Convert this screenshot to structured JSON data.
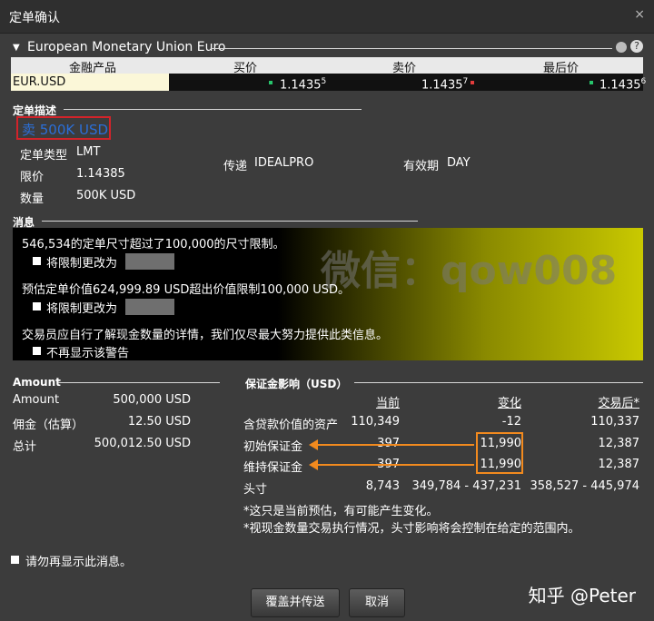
{
  "window": {
    "title": "定单确认",
    "close_icon": "×"
  },
  "instrument": {
    "name": "European Monetary Union Euro"
  },
  "quote_table": {
    "headers": [
      "金融产品",
      "买价",
      "卖价",
      "最后价"
    ],
    "row": {
      "symbol": "EUR.USD",
      "bid": "1.1435",
      "bid_sup": "5",
      "ask": "1.1435",
      "ask_sup": "7",
      "last": "1.1435",
      "last_sup": "6"
    }
  },
  "order": {
    "section": "定单描述",
    "side_text": "卖 500K USD",
    "type_label": "定单类型",
    "type_value": "LMT",
    "limit_label": "限价",
    "limit_value": "1.14385",
    "qty_label": "数量",
    "qty_value": "500K USD",
    "route_label": "传递",
    "route_value": "IDEALPRO",
    "tif_label": "有效期",
    "tif_value": "DAY"
  },
  "messages": {
    "section": "消息",
    "m1": "546,534的定单尺寸超过了100,000的尺寸限制。",
    "m1_opt": "将限制更改为",
    "m2": "预估定单价值624,999.89 USD超出价值限制100,000 USD。",
    "m2_opt": "将限制更改为",
    "m3": "交易员应自行了解现金数量的详情，我们仅尽最大努力提供此类信息。",
    "m3_opt": "不再显示该警告",
    "watermark": "微信：qow008"
  },
  "amount": {
    "section": "Amount",
    "rows": [
      {
        "label": "Amount",
        "value": "500,000 USD"
      },
      {
        "label": "佣金（估算）",
        "value": "12.50 USD"
      },
      {
        "label": "总计",
        "value": "500,012.50 USD"
      }
    ]
  },
  "margin": {
    "section": "保证金影响（USD）",
    "headers": [
      "当前",
      "变化",
      "交易后*"
    ],
    "rows": [
      {
        "label": "含贷款价值的资产",
        "current": "110,349",
        "change": "-12",
        "after": "110,337"
      },
      {
        "label": "初始保证金",
        "current": "397",
        "change": "11,990",
        "after": "12,387"
      },
      {
        "label": "维持保证金",
        "current": "397",
        "change": "11,990",
        "after": "12,387"
      },
      {
        "label": "头寸",
        "current": "8,743",
        "change": "349,784 - 437,231",
        "after": "358,527 - 445,974"
      }
    ],
    "note1": "*这只是当前预估，有可能产生变化。",
    "note2": "*视现金数量交易执行情况，头寸影响将会控制在给定的范围内。"
  },
  "footer": {
    "dont_show": "请勿再显示此消息。",
    "override_button": "覆盖并传送",
    "cancel_button": "取消",
    "watermark": "知乎 @Peter"
  }
}
